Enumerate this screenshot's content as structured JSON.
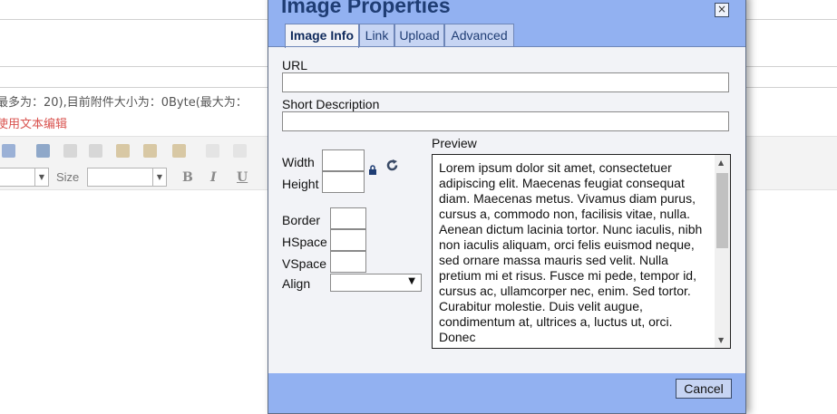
{
  "background": {
    "info_line": "最多为：20),目前附件大小为：0Byte(最大为：",
    "edit_link": "使用文本编辑",
    "size_label": "Size",
    "bold_label": "B",
    "italic_label": "I",
    "underline_label": "U",
    "link_color": "#d9534f"
  },
  "dialog": {
    "title": "Image Properties",
    "close_label": "×",
    "tabs": [
      {
        "label": "Image Info",
        "active": true
      },
      {
        "label": "Link",
        "active": false
      },
      {
        "label": "Upload",
        "active": false
      },
      {
        "label": "Advanced",
        "active": false
      }
    ],
    "fields": {
      "url_label": "URL",
      "url_value": "",
      "desc_label": "Short Description",
      "desc_value": "",
      "width_label": "Width",
      "width_value": "",
      "height_label": "Height",
      "height_value": "",
      "border_label": "Border",
      "border_value": "",
      "hspace_label": "HSpace",
      "hspace_value": "",
      "vspace_label": "VSpace",
      "vspace_value": "",
      "align_label": "Align",
      "align_value": "",
      "align_arrow": "▼"
    },
    "preview": {
      "label": "Preview",
      "text": "Lorem ipsum dolor sit amet, consectetuer adipiscing elit. Maecenas feugiat consequat diam. Maecenas metus. Vivamus diam purus, cursus a, commodo non, facilisis vitae, nulla. Aenean dictum lacinia tortor. Nunc iaculis, nibh non iaculis aliquam, orci felis euismod neque, sed ornare massa mauris sed velit. Nulla pretium mi et risus. Fusce mi pede, tempor id, cursus ac, ullamcorper nec, enim. Sed tortor. Curabitur molestie. Duis velit augue, condimentum at, ultrices a, luctus ut, orci. Donec"
    },
    "cancel_label": "Cancel",
    "colors": {
      "title_bar": "#92b1f1",
      "title_text": "#1f3d74",
      "body": "#f2f3f7"
    }
  }
}
